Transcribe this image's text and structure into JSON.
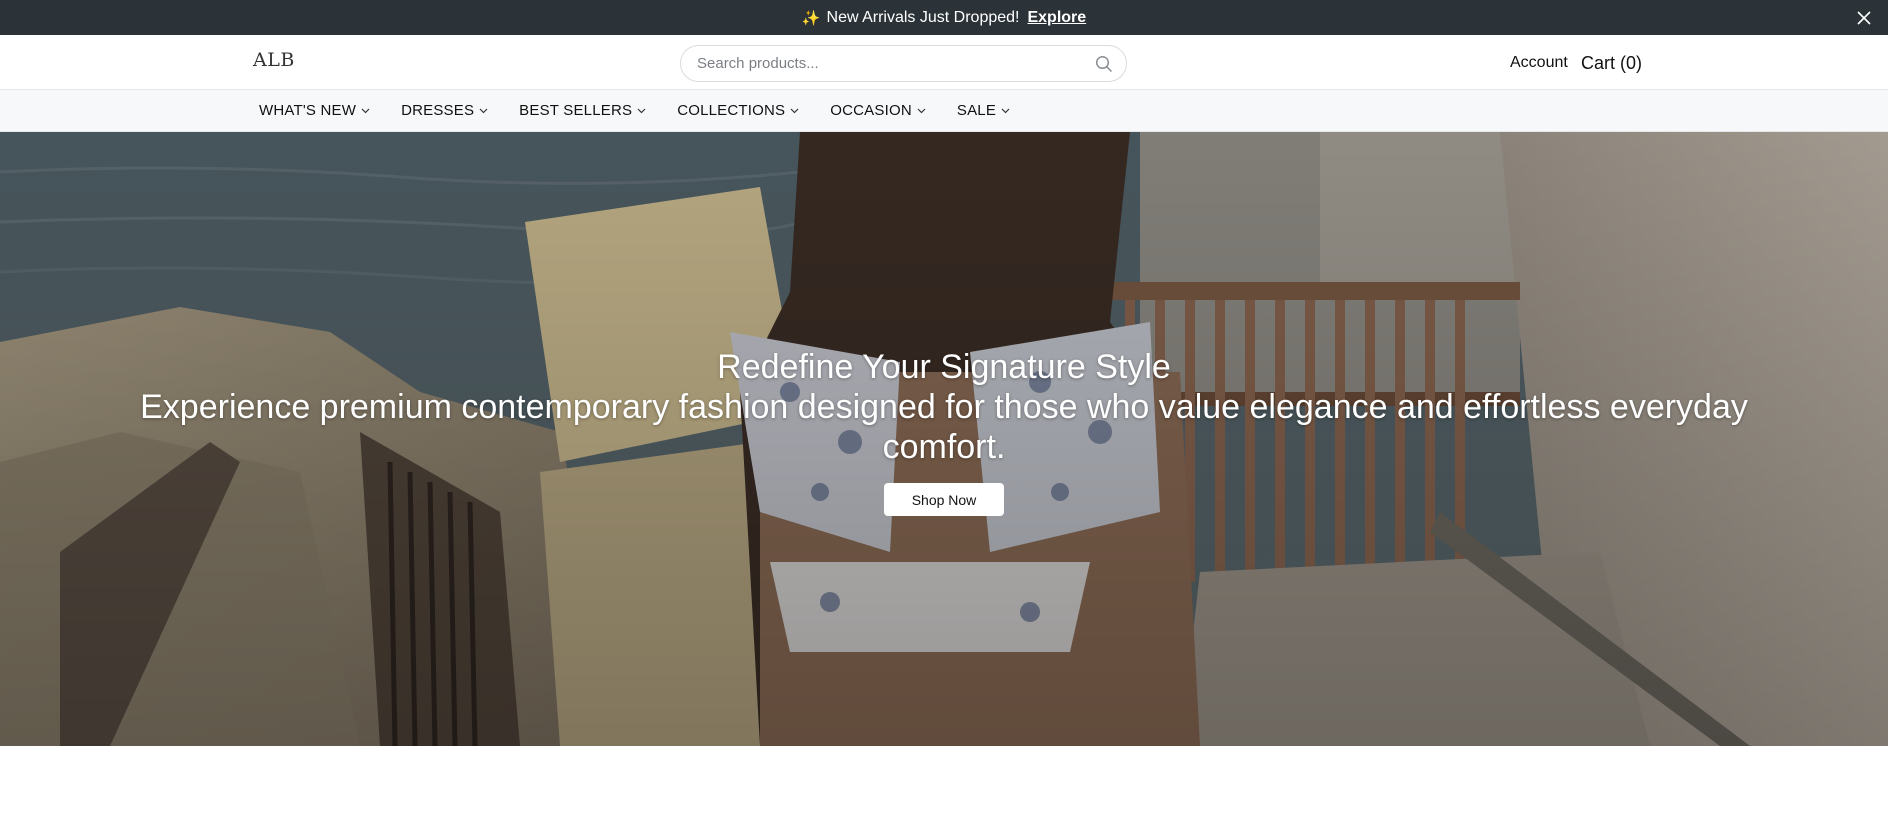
{
  "announcement": {
    "sparkle": "✨",
    "message": "New Arrivals Just Dropped!",
    "link_label": "Explore",
    "close_glyph": "✕"
  },
  "header": {
    "logo": "ALB",
    "search_placeholder": "Search products...",
    "account_label": "Account",
    "cart_label": "Cart (0)"
  },
  "nav": {
    "items": [
      {
        "label": "WHAT'S NEW"
      },
      {
        "label": "DRESSES"
      },
      {
        "label": "BEST SELLERS"
      },
      {
        "label": "COLLECTIONS"
      },
      {
        "label": "OCCASION"
      },
      {
        "label": "SALE"
      }
    ]
  },
  "hero": {
    "title": "Redefine Your Signature Style",
    "subtitle": "Experience premium contemporary fashion designed for those who value elegance and effortless everyday comfort.",
    "cta_label": "Shop Now"
  },
  "colors": {
    "announcement_bg": "#2b3338",
    "nav_bg": "#f7f8f9",
    "button_bg": "#ffffff"
  }
}
